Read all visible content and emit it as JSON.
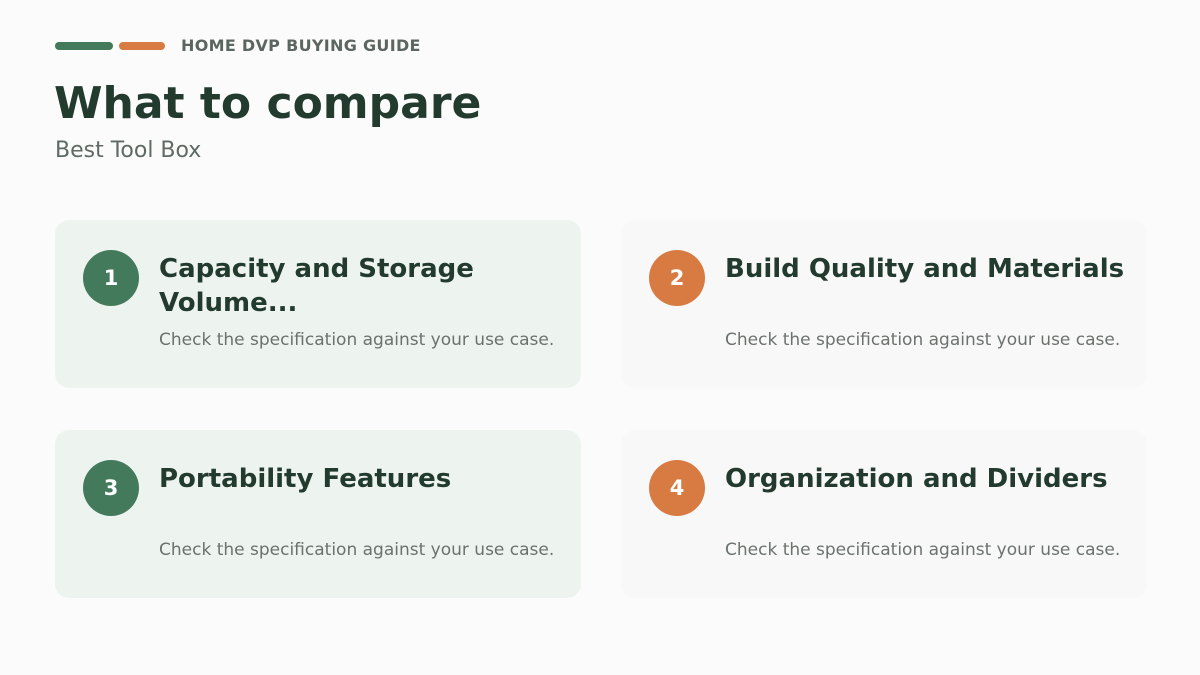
{
  "colors": {
    "accent_green": "#437a5c",
    "accent_orange": "#d87b42"
  },
  "header": {
    "eyebrow": "HOME DVP BUYING GUIDE",
    "title": "What to compare",
    "subtitle": "Best Tool Box"
  },
  "cards": [
    {
      "number": "1",
      "title": "Capacity and Storage Volume...",
      "description": "Check the specification against your use case."
    },
    {
      "number": "2",
      "title": "Build Quality and Materials",
      "description": "Check the specification against your use case."
    },
    {
      "number": "3",
      "title": "Portability Features",
      "description": "Check the specification against your use case."
    },
    {
      "number": "4",
      "title": "Organization and Dividers",
      "description": "Check the specification against your use case."
    }
  ]
}
